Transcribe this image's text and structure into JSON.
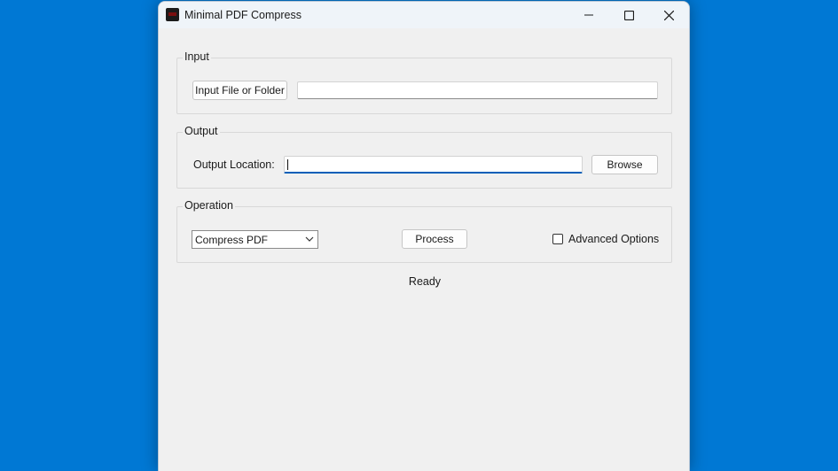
{
  "colors": {
    "desktop": "#0078d4",
    "window_bg": "#f0f0f0",
    "accent": "#005fb8"
  },
  "window": {
    "title": "Minimal PDF Compress",
    "icon": "pdf-app-icon",
    "controls": {
      "minimize": "minimize-icon",
      "maximize": "maximize-icon",
      "close": "close-icon"
    }
  },
  "input_group": {
    "label": "Input",
    "button_label": "Input File or Folder",
    "path_value": ""
  },
  "output_group": {
    "label": "Output",
    "location_label": "Output Location:",
    "location_value": "",
    "browse_label": "Browse"
  },
  "operation_group": {
    "label": "Operation",
    "selected_operation": "Compress PDF",
    "process_label": "Process",
    "advanced_label": "Advanced Options",
    "advanced_checked": false
  },
  "status": "Ready"
}
